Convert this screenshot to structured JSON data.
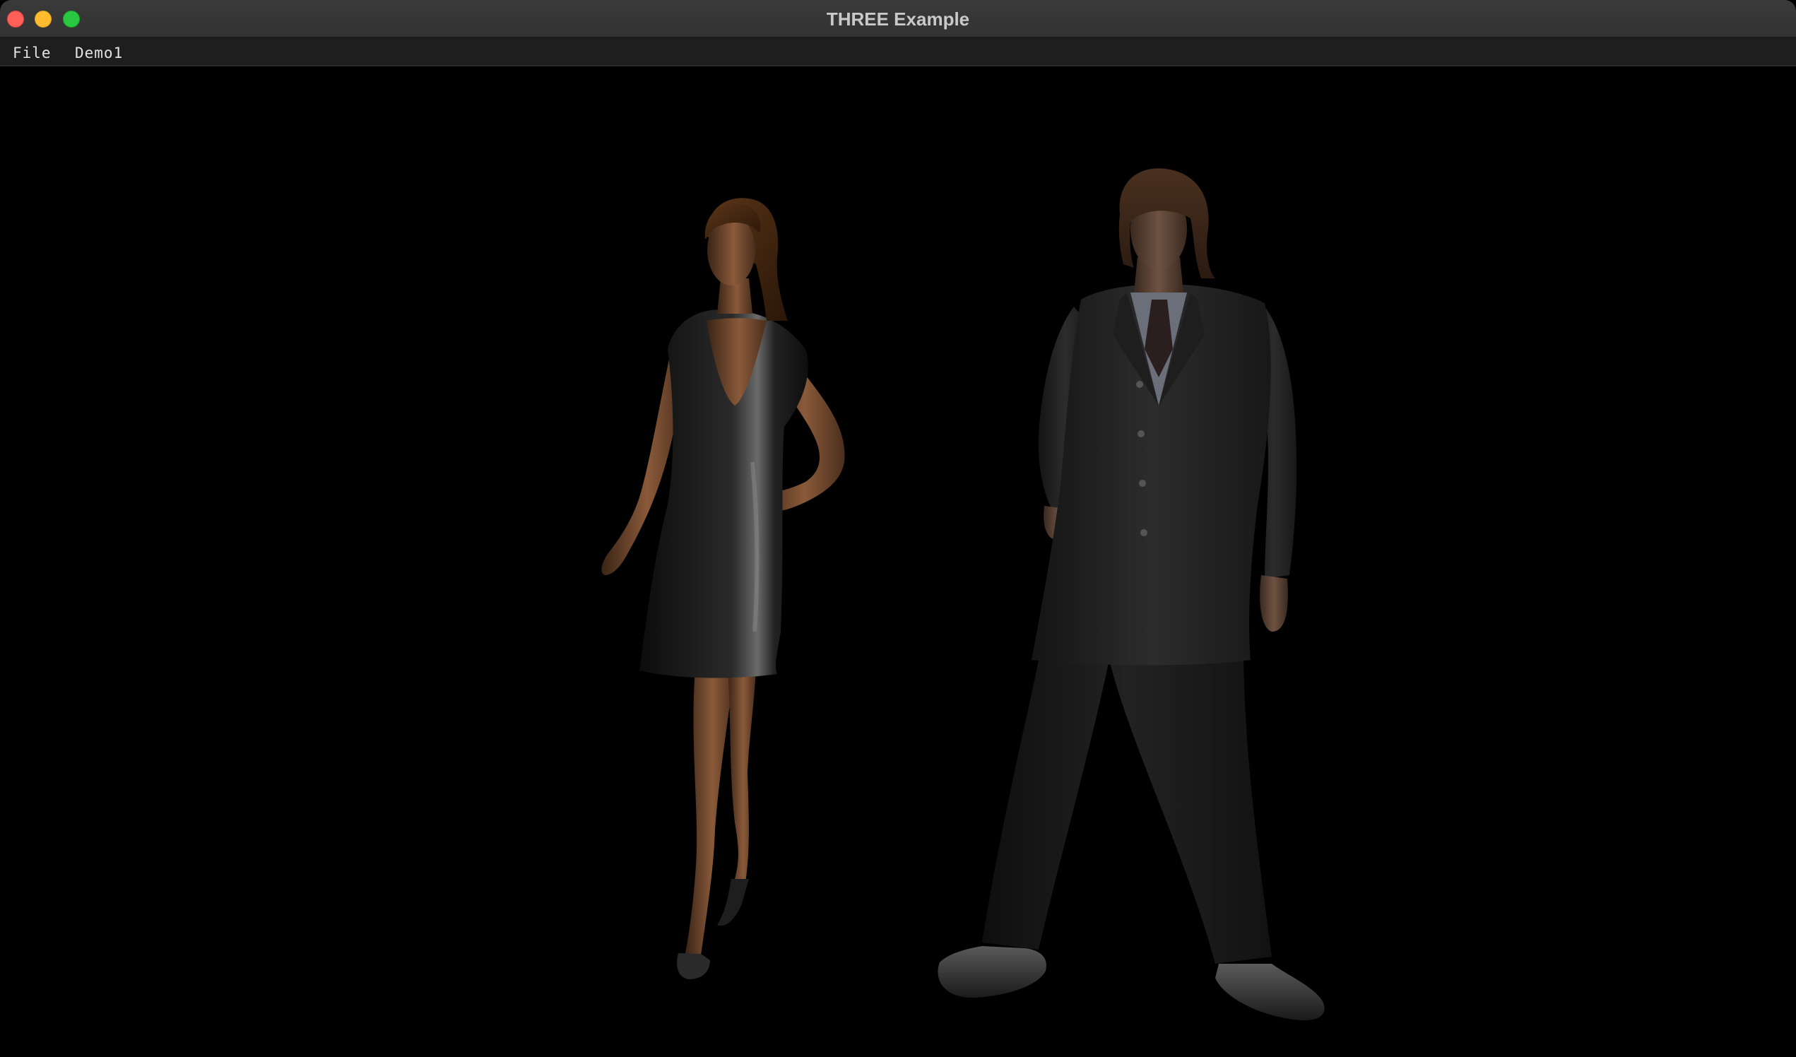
{
  "window": {
    "title": "THREE Example",
    "controls": {
      "close": "close-button",
      "minimize": "minimize-button",
      "zoom": "zoom-button"
    }
  },
  "menubar": {
    "items": [
      {
        "label": "File"
      },
      {
        "label": "Demo1"
      }
    ]
  },
  "viewport": {
    "background": "#000000",
    "scene": "two 3D characters: woman in black dress, man in dark pinstripe suit"
  },
  "colors": {
    "close": "#fe5f57",
    "minimize": "#febc2e",
    "zoom": "#28c840",
    "titlebar": "#363636",
    "menubar": "#1e1e1e"
  }
}
